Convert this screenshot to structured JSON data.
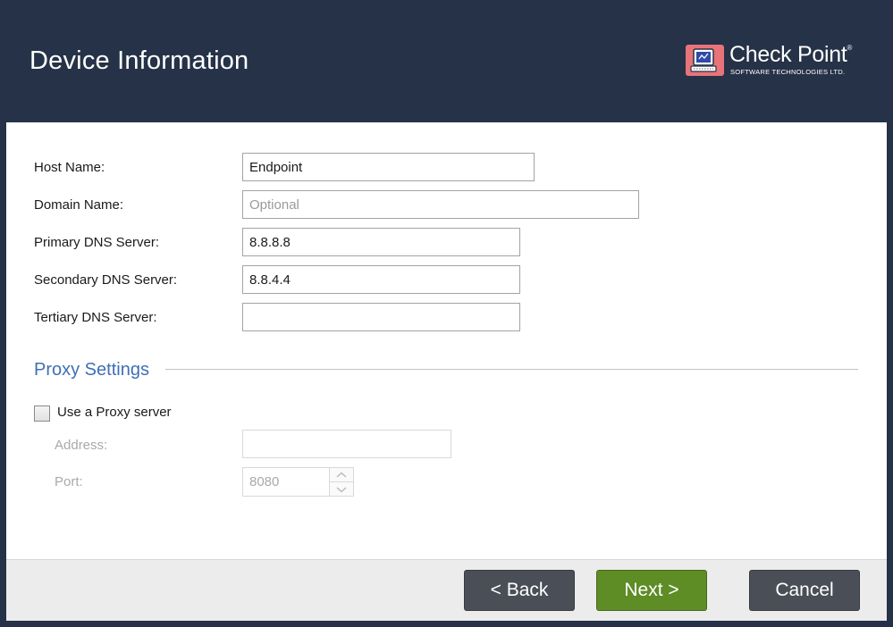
{
  "header": {
    "title": "Device Information",
    "logo": {
      "name": "Check Point",
      "trademark": "®",
      "tagline": "SOFTWARE TECHNOLOGIES LTD.",
      "icon": "checkpoint-logo-icon",
      "color": "#e8747a"
    },
    "background_color": "#253247"
  },
  "form": {
    "host_name": {
      "label": "Host Name:",
      "value": "Endpoint",
      "placeholder": ""
    },
    "domain_name": {
      "label": "Domain Name:",
      "value": "",
      "placeholder": "Optional"
    },
    "primary_dns": {
      "label": "Primary DNS Server:",
      "value": "8.8.8.8",
      "placeholder": ""
    },
    "secondary_dns": {
      "label": "Secondary DNS Server:",
      "value": "8.8.4.4",
      "placeholder": ""
    },
    "tertiary_dns": {
      "label": "Tertiary DNS Server:",
      "value": "",
      "placeholder": ""
    }
  },
  "proxy": {
    "section_title": "Proxy Settings",
    "section_title_color": "#3f6fb5",
    "use_proxy": {
      "label": "Use a Proxy server",
      "checked": false
    },
    "address": {
      "label": "Address:",
      "value": "",
      "enabled": false
    },
    "port": {
      "label": "Port:",
      "value": "8080",
      "enabled": false
    }
  },
  "footer": {
    "back_label": "< Back",
    "next_label": "Next >",
    "cancel_label": "Cancel",
    "next_color": "#5e8c25",
    "secondary_color": "#4a4f57"
  }
}
